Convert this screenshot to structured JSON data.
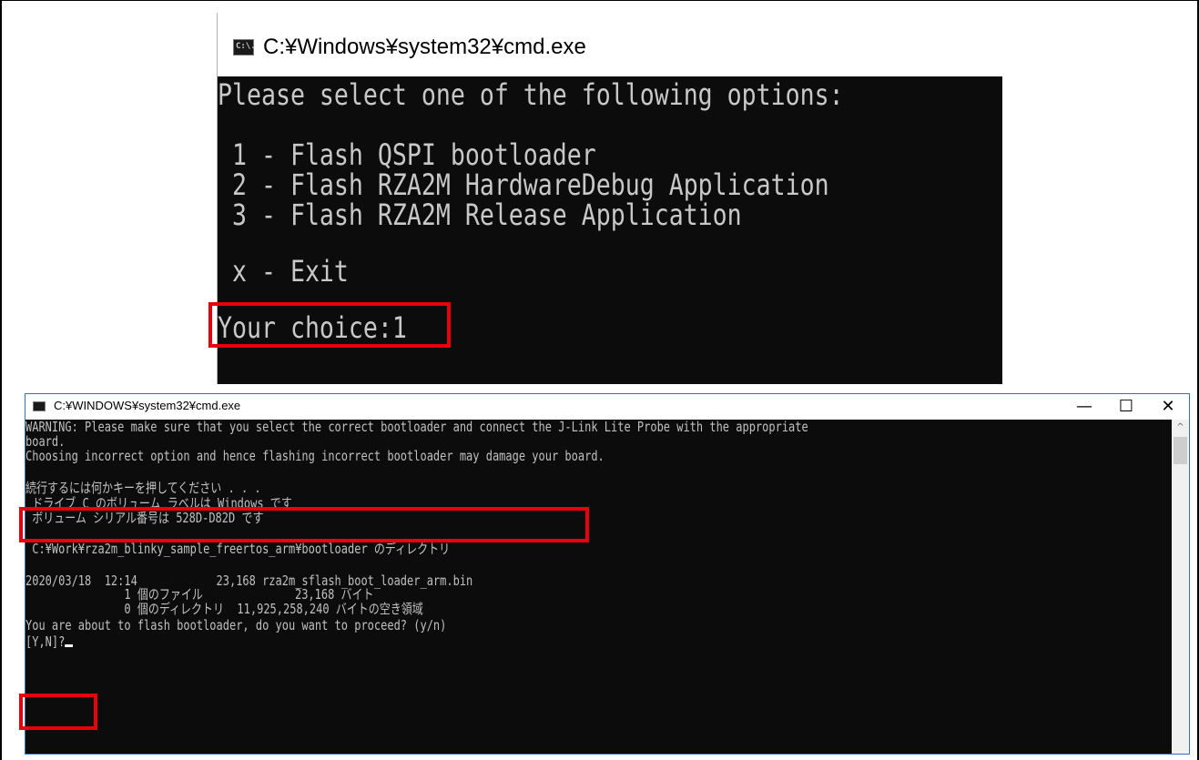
{
  "top_window": {
    "title": "C:¥Windows¥system32¥cmd.exe",
    "icon": "cmd-icon",
    "icon_text": "C:\\.",
    "lines": [
      "Please select one of the following options:",
      "",
      " 1 - Flash QSPI bootloader",
      " 2 - Flash RZA2M HardwareDebug Application",
      " 3 - Flash RZA2M Release Application",
      "",
      " x - Exit",
      "",
      "Your choice:1"
    ]
  },
  "bottom_window": {
    "title": "C:¥WINDOWS¥system32¥cmd.exe",
    "icon": "cmd-icon",
    "minimize": "—",
    "maximize": "☐",
    "close": "✕",
    "scroll_up": "^",
    "lines": [
      "WARNING: Please make sure that you select the correct bootloader and connect the J-Link Lite Probe with the appropriate",
      "board.",
      "Choosing incorrect option and hence flashing incorrect bootloader may damage your board.",
      "",
      "続行するには何かキーを押してください . . .",
      " ドライブ C のボリューム ラベルは Windows です",
      " ボリューム シリアル番号は 528D-D82D です",
      "",
      " C:¥Work¥rza2m_blinky_sample_freertos_arm¥bootloader のディレクトリ",
      "",
      "2020/03/18  12:14            23,168 rza2m_sflash_boot_loader_arm.bin",
      "               1 個のファイル              23,168 バイト",
      "               0 個のディレクトリ  11,925,258,240 バイトの空き領域",
      "You are about to flash bootloader, do you want to proceed? (y/n)",
      "[Y,N]?"
    ]
  },
  "colors": {
    "highlight": "#e8000b",
    "console_bg": "#0c0c0c",
    "console_text": "#c0c0c0"
  }
}
